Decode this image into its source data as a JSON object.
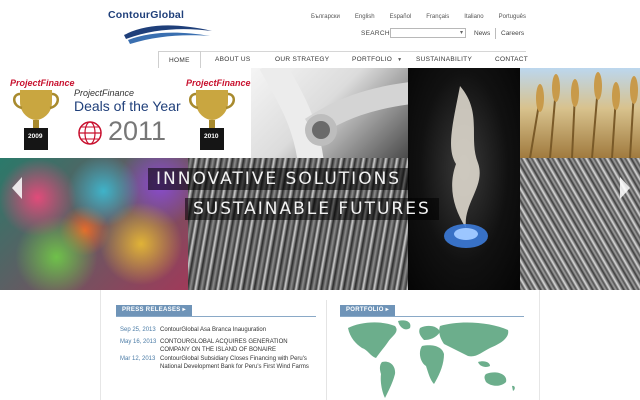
{
  "header": {
    "logo_text": "ContourGlobal",
    "languages": [
      "Български",
      "English",
      "Español",
      "Français",
      "Italiano",
      "Português"
    ],
    "search_label": "SEARCH",
    "search_value": "",
    "top_links": [
      "News",
      "Careers"
    ]
  },
  "nav": {
    "items": [
      {
        "label": "HOME",
        "active": true
      },
      {
        "label": "ABOUT US"
      },
      {
        "label": "OUR STRATEGY"
      },
      {
        "label": "PORTFOLIO",
        "has_dropdown": true
      },
      {
        "label": "SUSTAINABILITY"
      },
      {
        "label": "CONTACT"
      }
    ]
  },
  "banner": {
    "tagline_line1": "INNOVATIVE SOLUTIONS",
    "tagline_line2": "SUSTAINABLE FUTURES",
    "awards": {
      "left_brand": "ProjectFinance",
      "left_year": "2009",
      "center_brand": "ProjectFinance",
      "center_title": "Deals of the Year",
      "center_year": "2011",
      "right_brand": "ProjectFinance",
      "right_year": "2010"
    },
    "prev_icon": "chevron-left-icon",
    "next_icon": "chevron-right-icon"
  },
  "press": {
    "title": "PRESS RELEASES",
    "items": [
      {
        "date": "Sep 25, 2013",
        "text_line1": "ContourGlobal Asa Branca Inauguration",
        "text_line2": ""
      },
      {
        "date": "May 16, 2013",
        "text_line1": "CONTOURGLOBAL ACQUIRES GENERATION",
        "text_line2": "COMPANY ON THE ISLAND OF BONAIRE"
      },
      {
        "date": "Mar 12, 2013",
        "text_line1": "ContourGlobal Subsidiary Closes Financing with Peru's",
        "text_line2": "National Development Bank for Peru's First Wind Farms"
      }
    ]
  },
  "portfolio": {
    "title": "PORTFOLIO"
  },
  "colors": {
    "brand_navy": "#1f3f7a",
    "section_tab": "#6f94b8",
    "map_green": "#6cae8c",
    "date_blue": "#4a7ba6"
  }
}
